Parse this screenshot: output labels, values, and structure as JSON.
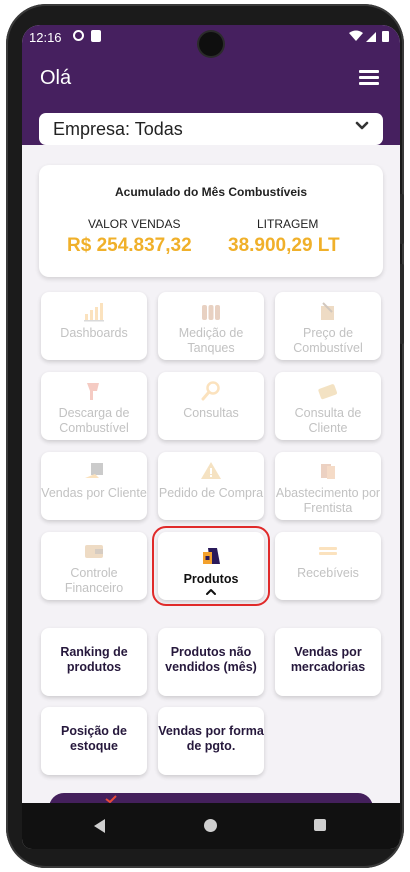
{
  "status_bar": {
    "time": "12:16"
  },
  "header": {
    "greeting": "Olá"
  },
  "company_select": {
    "value": "Empresa: Todas"
  },
  "summary": {
    "title": "Acumulado do Mês Combustíveis",
    "sales_label": "VALOR VENDAS",
    "sales_value": "R$ 254.837,32",
    "volume_label": "LITRAGEM",
    "volume_value": "38.900,29 LT"
  },
  "menu": [
    {
      "label": "Dashboards",
      "icon": "bar-chart-icon"
    },
    {
      "label": "Medição de Tanques",
      "icon": "tanks-icon"
    },
    {
      "label": "Preço de Combustível",
      "icon": "fuel-price-icon"
    },
    {
      "label": "Descarga de Combustível",
      "icon": "fuel-nozzle-icon"
    },
    {
      "label": "Consultas",
      "icon": "magnifier-icon"
    },
    {
      "label": "Consulta de Cliente",
      "icon": "client-card-icon"
    },
    {
      "label": "Vendas por Cliente",
      "icon": "client-sales-icon"
    },
    {
      "label": "Pedido de Compra",
      "icon": "warning-icon"
    },
    {
      "label": "Abastecimento por Frentista",
      "icon": "attendant-icon"
    },
    {
      "label": "Controle Financeiro",
      "icon": "wallet-icon"
    },
    {
      "label": "Produtos",
      "icon": "shopping-bag-icon"
    },
    {
      "label": "Recebíveis",
      "icon": "receivables-icon"
    }
  ],
  "products_submenu": [
    {
      "label": "Ranking de produtos"
    },
    {
      "label": "Produtos não vendidos (mês)"
    },
    {
      "label": "Vendas por mercadorias"
    },
    {
      "label": "Posição de estoque"
    },
    {
      "label": "Vendas por forma de pgto."
    }
  ],
  "colors": {
    "header": "#46205f",
    "accent_values": "#f0b02a",
    "highlight": "#e02a2a"
  }
}
